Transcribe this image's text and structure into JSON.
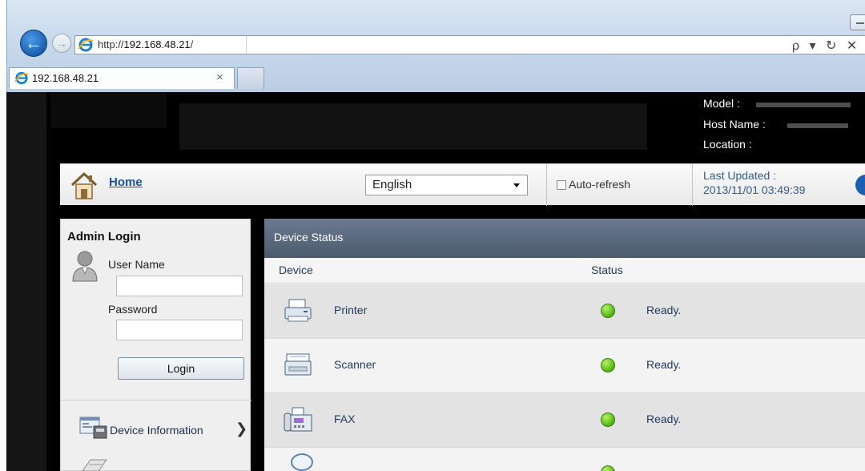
{
  "browser": {
    "url_prefix": "http://",
    "url_host": "192.168.48.21",
    "url_suffix": "/",
    "tab_title": "192.168.48.21",
    "tab_close": "×",
    "back_glyph": "←",
    "forward_glyph": "→",
    "address_tools": "ρ ▾ ↻ ✕"
  },
  "device_info": {
    "model_label": "Model :",
    "host_label": "Host Name :",
    "location_label": "Location :"
  },
  "toolbar": {
    "home_label": "Home",
    "language": "English",
    "auto_refresh_label": "Auto-refresh",
    "last_updated_label": "Last Updated :",
    "last_updated_value": "2013/11/01 03:49:39"
  },
  "sidebar": {
    "title": "Admin Login",
    "username_label": "User Name",
    "password_label": "Password",
    "login_button": "Login",
    "nav_device_info": "Device Information",
    "nav_arrow": "❯"
  },
  "main": {
    "header": "Device Status",
    "col_device": "Device",
    "col_status": "Status",
    "rows": [
      {
        "name": "Printer",
        "status": "Ready."
      },
      {
        "name": "Scanner",
        "status": "Ready."
      },
      {
        "name": "FAX",
        "status": "Ready."
      }
    ],
    "status_color": "#5cbf18"
  },
  "icons": [
    "ie-logo-icon",
    "home-icon",
    "user-avatar-icon",
    "device-info-icon",
    "printer-icon",
    "scanner-icon",
    "fax-icon"
  ]
}
